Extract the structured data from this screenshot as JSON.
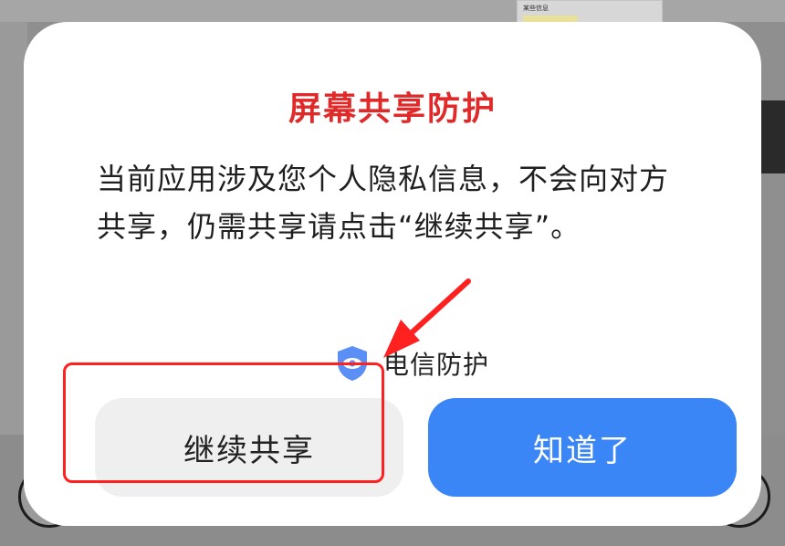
{
  "background": {
    "thumbnail_text": "某些信息"
  },
  "dialog": {
    "title": "屏幕共享防护",
    "body": "当前应用涉及您个人隐私信息，不会向对方共享，仍需共享请点击“继续共享”。",
    "badge_label": "电信防护",
    "badge_icon": "shield-eye-icon",
    "continue_button": "继续共享",
    "ok_button": "知道了"
  },
  "colors": {
    "title": "#e02a2a",
    "primary_button": "#3b86f7",
    "secondary_button": "#efefef",
    "highlight_frame": "#ff2020",
    "shield": "#5b8ff5"
  }
}
